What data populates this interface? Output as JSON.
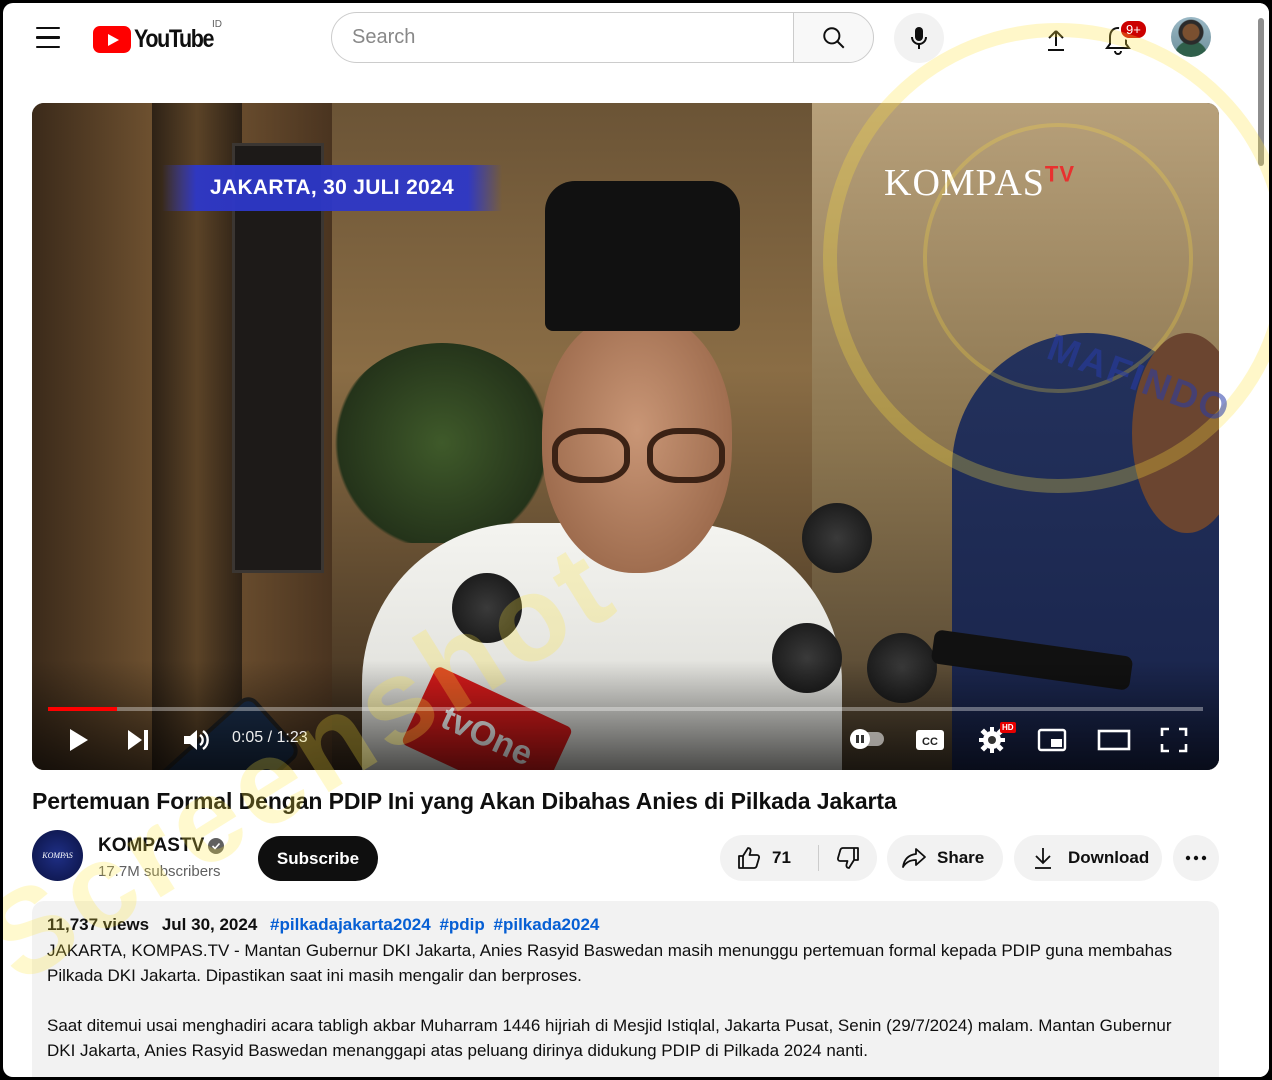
{
  "header": {
    "logo_text": "YouTube",
    "region_code": "ID",
    "search_placeholder": "Search",
    "notification_count": "9+"
  },
  "player": {
    "overlay_date": "JAKARTA, 30 JULI 2024",
    "overlay_channel": "KOMPAS",
    "overlay_channel_suffix": "TV",
    "mic_label": "tvOne",
    "current_time": "0:05",
    "duration": "1:23",
    "time_display": "0:05 / 1:23",
    "progress_fraction": 0.06,
    "quality_badge": "HD"
  },
  "video": {
    "title": "Pertemuan Formal Dengan PDIP Ini yang Akan Dibahas Anies di Pilkada Jakarta"
  },
  "channel": {
    "name": "KOMPASTV",
    "avatar_text": "KOMPAS",
    "subscribers": "17.7M subscribers",
    "subscribe_label": "Subscribe"
  },
  "actions": {
    "like_count": "71",
    "share_label": "Share",
    "download_label": "Download"
  },
  "description": {
    "views": "11,737 views",
    "date": "Jul 30, 2024",
    "hashtags": [
      "#pilkadajakarta2024",
      "#pdip",
      "#pilkada2024"
    ],
    "paragraph_1": "JAKARTA, KOMPAS.TV - Mantan Gubernur DKI Jakarta, Anies Rasyid Baswedan masih menunggu pertemuan formal kepada PDIP guna membahas Pilkada DKI Jakarta. Dipastikan saat ini masih mengalir dan berproses.",
    "paragraph_2": "Saat ditemui usai menghadiri acara tabligh akbar Muharram 1446 hijriah di Mesjid Istiqlal, Jakarta Pusat, Senin (29/7/2024) malam. Mantan Gubernur DKI Jakarta, Anies Rasyid Baswedan menanggapi atas peluang dirinya didukung PDIP di Pilkada 2024 nanti."
  },
  "colors": {
    "brand_red": "#ff0000",
    "hashtag_blue": "#065fd4",
    "subscribe_bg": "#0f0f0f",
    "overlay_banner": "#2d37c8"
  },
  "icons": {
    "menu": "hamburger-icon",
    "search": "search-icon",
    "mic": "microphone-icon",
    "upload": "upload-icon",
    "notifications": "bell-icon",
    "play": "play-icon",
    "next": "skip-next-icon",
    "volume": "volume-icon",
    "captions": "cc-icon",
    "settings": "gear-icon",
    "miniplayer": "miniplayer-icon",
    "theater": "theater-icon",
    "fullscreen": "fullscreen-icon",
    "like": "thumbs-up-icon",
    "dislike": "thumbs-down-icon",
    "share": "share-arrow-icon",
    "download": "download-icon",
    "more": "more-horizontal-icon"
  }
}
